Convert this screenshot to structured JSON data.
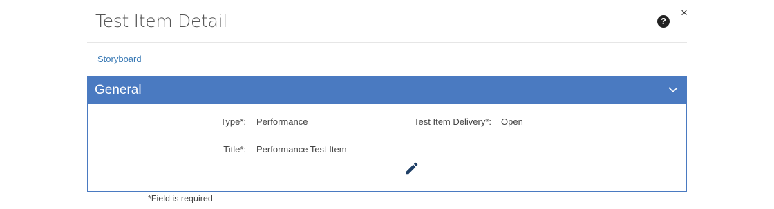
{
  "dialog": {
    "title": "Test Item Detail",
    "help_icon": "question-circle-icon",
    "help_glyph": "?",
    "close_icon": "close-icon",
    "close_glyph": "×"
  },
  "breadcrumb": {
    "link": "Storyboard"
  },
  "general_panel": {
    "title": "General",
    "collapse_icon": "chevron-down-icon",
    "accent_color": "#4a7ac1",
    "fields": {
      "type_label": "Type*:",
      "type_value": "Performance",
      "delivery_label": "Test Item Delivery*:",
      "delivery_value": "Open",
      "title_label": "Title*:",
      "title_value": "Performance Test Item"
    },
    "edit_icon": "pencil-icon"
  },
  "footer": {
    "required_note": "*Field is required"
  }
}
